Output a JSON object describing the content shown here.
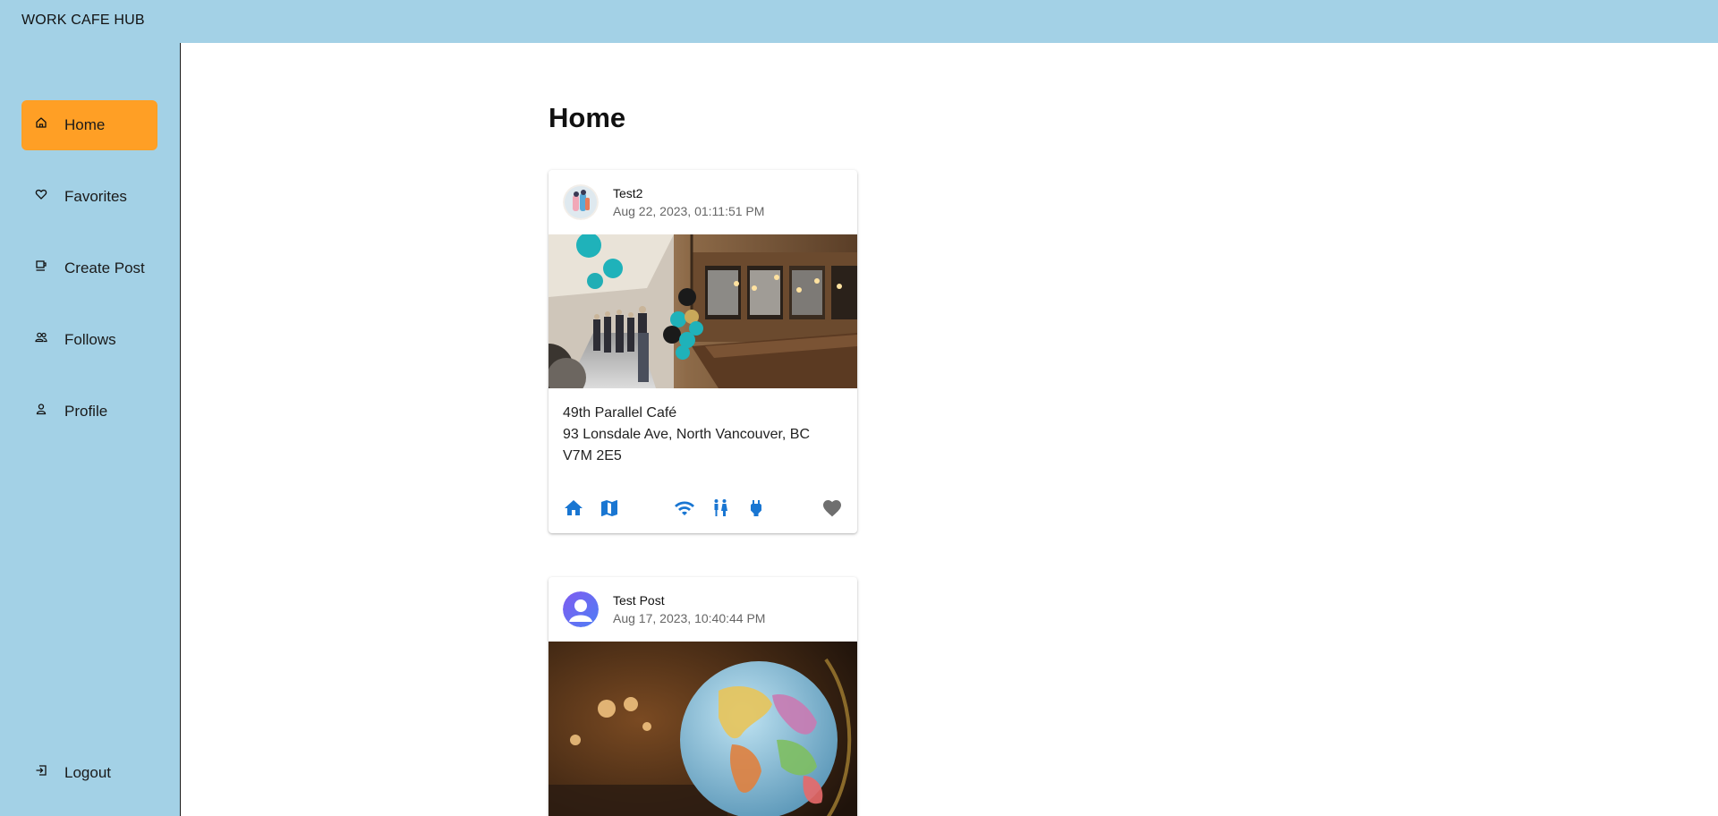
{
  "app": {
    "title": "WORK CAFE HUB"
  },
  "sidebar": {
    "items": [
      {
        "label": "Home",
        "icon": "home-icon",
        "active": true
      },
      {
        "label": "Favorites",
        "icon": "heart-icon",
        "active": false
      },
      {
        "label": "Create Post",
        "icon": "create-post-icon",
        "active": false
      },
      {
        "label": "Follows",
        "icon": "people-icon",
        "active": false
      },
      {
        "label": "Profile",
        "icon": "person-icon",
        "active": false
      }
    ],
    "logout": {
      "label": "Logout",
      "icon": "logout-icon"
    }
  },
  "main": {
    "title": "Home",
    "posts": [
      {
        "username": "Test2",
        "timestamp": "Aug 22, 2023, 01:11:51 PM",
        "cafe_name": "49th Parallel Café",
        "address": "93 Lonsdale Ave, North Vancouver, BC V7M 2E5",
        "image": "cafe-interior-photo",
        "actions": [
          "home-icon",
          "map-icon",
          "wifi-icon",
          "restroom-icon",
          "outlet-icon",
          "favorite-heart-icon"
        ]
      },
      {
        "username": "Test Post",
        "timestamp": "Aug 17, 2023, 10:40:44 PM",
        "image": "globe-photo"
      }
    ]
  },
  "colors": {
    "sidebar_bg": "#a3d1e6",
    "active_item": "#ff9f25",
    "icon_blue": "#1976d2",
    "heart_gray": "#6f6f6f"
  }
}
